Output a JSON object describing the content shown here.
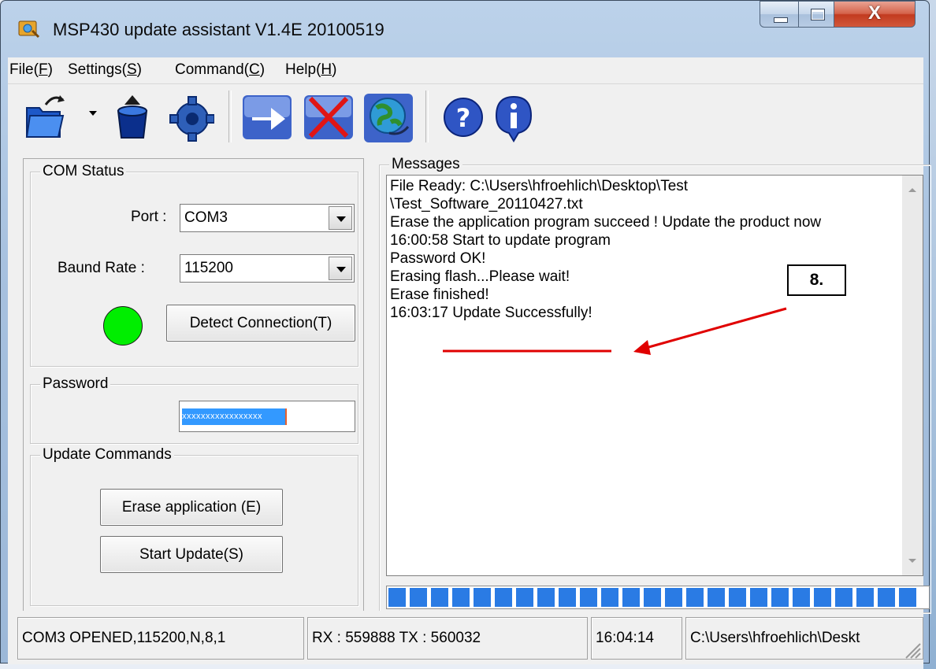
{
  "window": {
    "title": "MSP430 update assistant V1.4E  20100519",
    "close_glyph": "X"
  },
  "menu": {
    "items": [
      {
        "label": "File(F)",
        "x": 0
      },
      {
        "label": "Settings(S)",
        "x": 0
      },
      {
        "label": "Command(C)",
        "x": 0
      },
      {
        "label": "Help(H)",
        "x": 0
      }
    ]
  },
  "toolbar": {
    "icons": [
      "open-folder-icon",
      "dropdown-arrow-icon",
      "save-icon",
      "settings-gear-icon",
      "connect-arrow-icon",
      "disconnect-x-icon",
      "globe-update-icon",
      "help-question-icon",
      "info-icon"
    ]
  },
  "com_status": {
    "title": "COM Status",
    "port_label": "Port :",
    "port_value": "COM3",
    "baud_label": "Baund Rate :",
    "baud_value": "115200",
    "connection_color": "#00ee00",
    "detect_button": "Detect Connection(T)"
  },
  "password": {
    "title": "Password",
    "masked_value": "xxxxxxxxxxxxxxxxx"
  },
  "update_commands": {
    "title": "Update Commands",
    "erase_button": "Erase application (E)",
    "start_button": "Start Update(S)"
  },
  "messages": {
    "title": "Messages",
    "lines": [
      "File Ready: C:\\Users\\hfroehlich\\Desktop\\Test",
      "\\Test_Software_20110427.txt",
      "Erase the application program succeed ! Update the product now",
      "16:00:58 Start to update program",
      "Password OK!",
      "Erasing flash...Please wait!",
      "Erase finished!",
      "16:03:17 Update Successfully!"
    ],
    "progress": 1.0,
    "progress_color": "#2a7be4"
  },
  "annotation": {
    "label": "8.",
    "color": "#e00000"
  },
  "status_bar": {
    "connection": "COM3 OPENED,115200,N,8,1",
    "traffic": "RX : 559888 TX : 560032",
    "time": "16:04:14",
    "path": "C:\\Users\\hfroehlich\\Deskt"
  }
}
